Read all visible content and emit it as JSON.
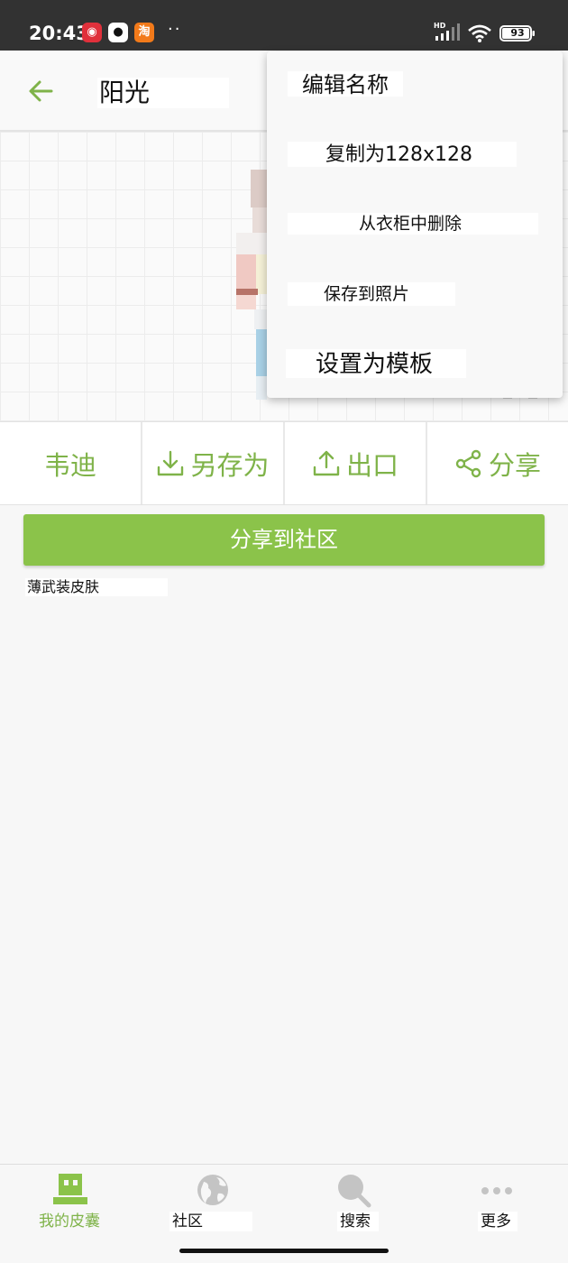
{
  "status_bar": {
    "time": "20:43",
    "app_icons": [
      "netease-music-icon",
      "qq-icon",
      "taobao-icon"
    ],
    "taobao_glyph": "淘",
    "overflow": "··",
    "network_badge": "HD",
    "battery": "93"
  },
  "app_bar": {
    "title": "阳光"
  },
  "menu": {
    "items": [
      {
        "label": "编辑名称"
      },
      {
        "label": "复制为128x128"
      },
      {
        "label": "从衣柜中删除"
      },
      {
        "label": "保存到照片"
      },
      {
        "label": "设置为模板"
      }
    ]
  },
  "actions": {
    "model": "韦迪",
    "save_as": "另存为",
    "export": "出口",
    "share": "分享"
  },
  "share_community": "分享到社区",
  "skin_name": "薄武装皮肤",
  "bottom_nav": {
    "items": [
      {
        "label": "我的皮囊",
        "icon": "skin-robot-icon",
        "active": true
      },
      {
        "label": "社区",
        "icon": "globe-icon",
        "active": false
      },
      {
        "label": "搜索",
        "icon": "search-icon",
        "active": false
      },
      {
        "label": "更多",
        "icon": "more-dots-icon",
        "active": false
      }
    ]
  },
  "colors": {
    "accent": "#8bc34a",
    "accent_text": "#7fb349",
    "status_bar": "#323232",
    "inactive_icon": "#c4c4c4"
  }
}
